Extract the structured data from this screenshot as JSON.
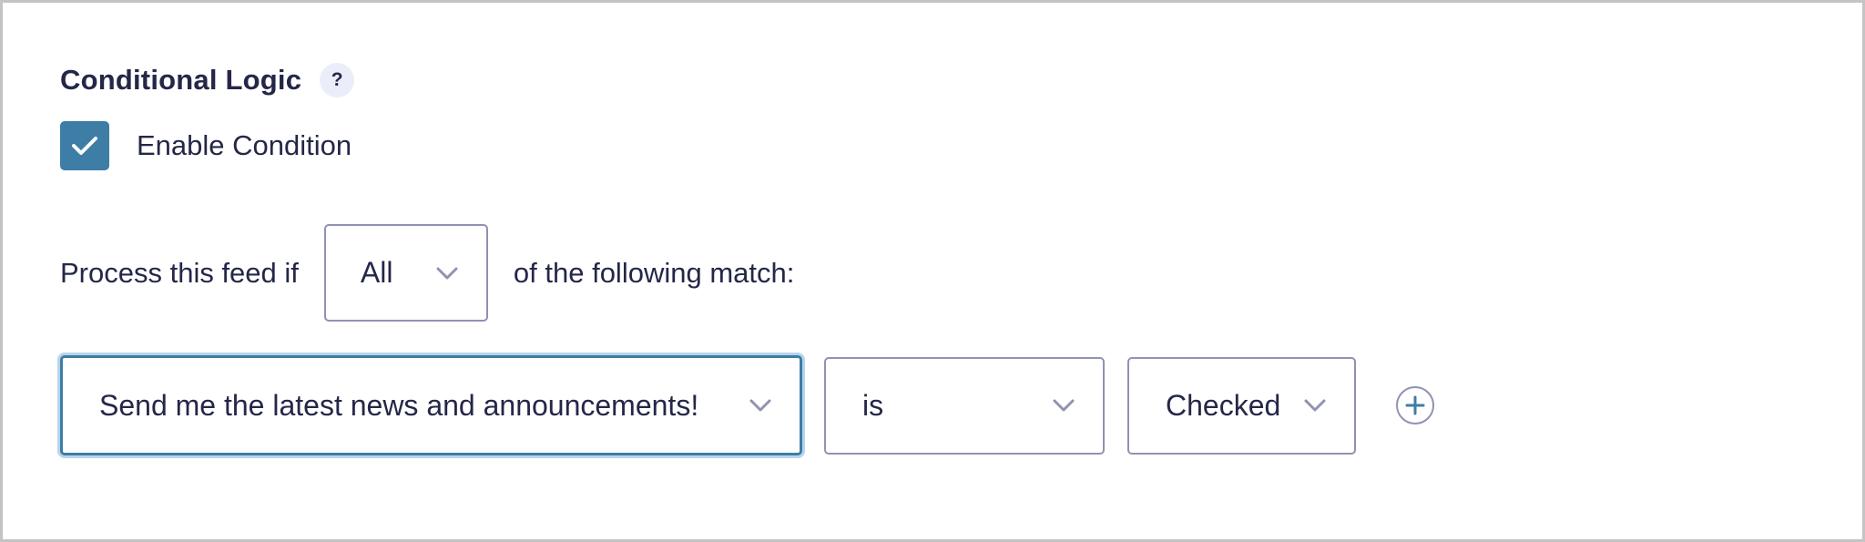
{
  "section": {
    "title": "Conditional Logic",
    "help_label": "?"
  },
  "enable": {
    "checked": true,
    "label": "Enable Condition"
  },
  "process": {
    "prefix": "Process this feed if",
    "match_type": "All",
    "suffix": "of the following match:"
  },
  "rule": {
    "field": "Send me the latest news and announcements!",
    "operator": "is",
    "value": "Checked"
  },
  "icons": {
    "help": "question-mark-icon",
    "checkbox": "checkmark-icon",
    "dropdown": "chevron-down-icon",
    "add": "plus-circle-icon"
  },
  "colors": {
    "text": "#242748",
    "accent": "#3e7da6",
    "border": "#9092b2",
    "help_bg": "#ebedfa",
    "focus_ring": "#b9d4ea"
  }
}
